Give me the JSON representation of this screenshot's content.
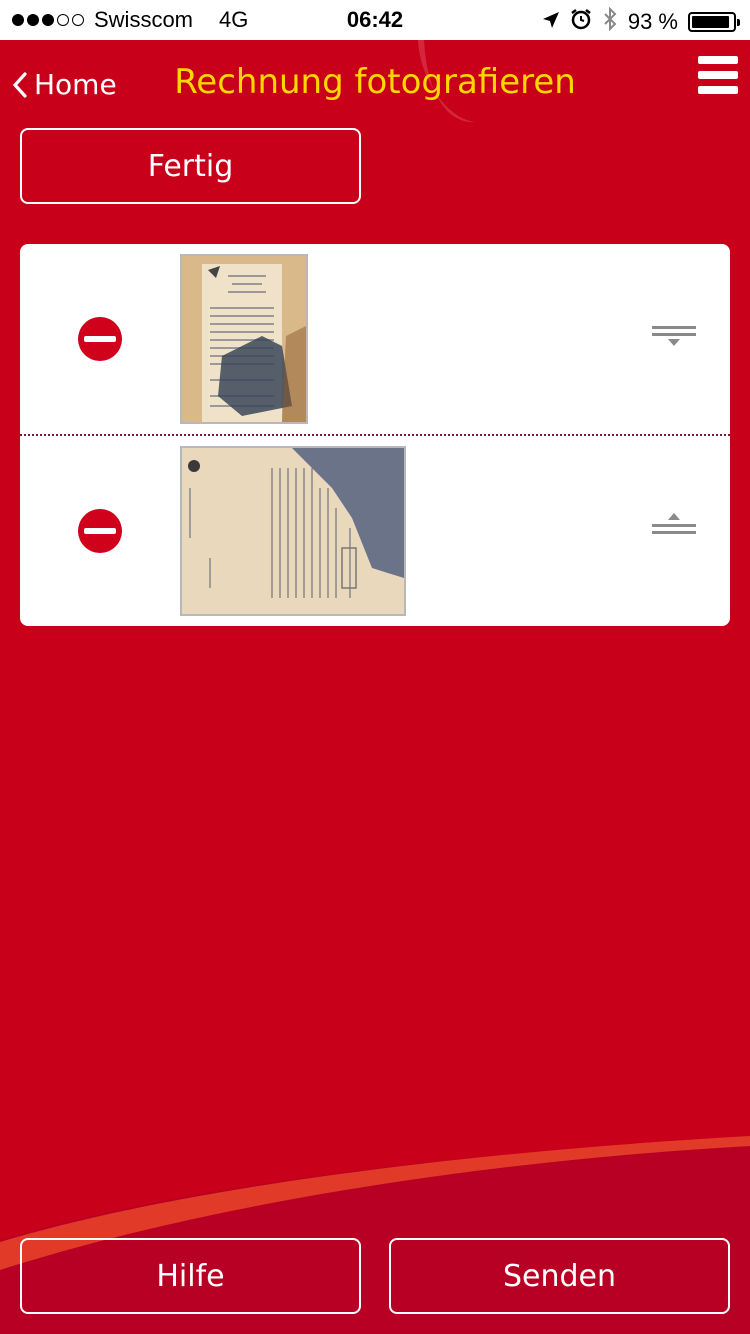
{
  "status_bar": {
    "signal_filled": 3,
    "signal_total": 5,
    "carrier": "Swisscom",
    "network": "4G",
    "time": "06:42",
    "battery_text": "93 %",
    "battery_level": 0.93,
    "icons": [
      "location-arrow-icon",
      "alarm-icon",
      "bluetooth-icon"
    ]
  },
  "nav": {
    "back_label": "Home",
    "title": "Rechnung fotografieren",
    "title_color": "#ffd700",
    "menu_icon": "hamburger-menu-icon"
  },
  "actions": {
    "done_label": "Fertig"
  },
  "photos": [
    {
      "delete_icon": "delete-minus-icon",
      "kind": "receipt-portrait",
      "reorder_icon": "move-down-icon"
    },
    {
      "delete_icon": "delete-minus-icon",
      "kind": "invoice-landscape",
      "reorder_icon": "move-up-icon"
    }
  ],
  "footer": {
    "help_label": "Hilfe",
    "send_label": "Senden"
  },
  "colors": {
    "brand_red": "#c8001a",
    "delete_red": "#d0021b",
    "accent_yellow": "#ffd700"
  }
}
